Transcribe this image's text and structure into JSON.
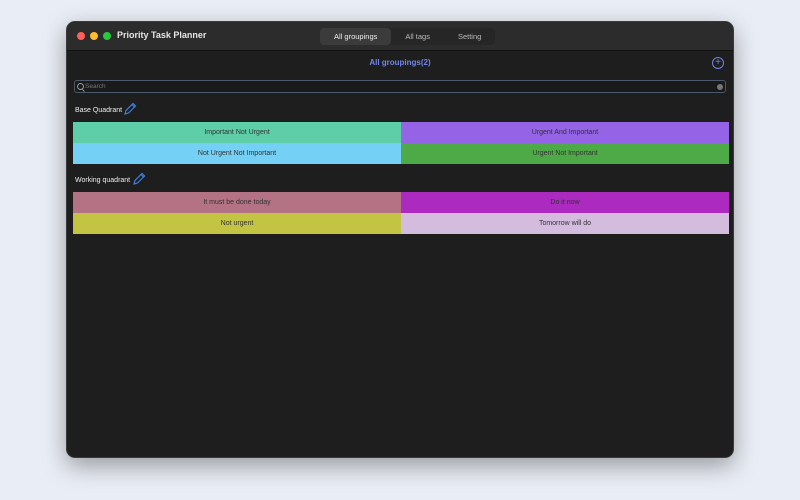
{
  "window": {
    "title": "Priority Task Planner"
  },
  "tabs": [
    {
      "label": "All groupings",
      "active": true
    },
    {
      "label": "All tags"
    },
    {
      "label": "Setting"
    }
  ],
  "header": {
    "title": "All groupings(2)",
    "add_icon": "plus-circle-icon"
  },
  "search": {
    "placeholder": "Search",
    "value": ""
  },
  "groups": [
    {
      "name": "Base Quadrant",
      "cells": [
        {
          "label": "Important Not Urgent",
          "color": "#5ecea8"
        },
        {
          "label": "Urgent And Important",
          "color": "#9463e6"
        },
        {
          "label": "Not Urgent Not Important",
          "color": "#74d0f4"
        },
        {
          "label": "Urgent Not Important",
          "color": "#4eaa47"
        }
      ]
    },
    {
      "name": "Working quadrant",
      "cells": [
        {
          "label": "It must be done today",
          "color": "#b47285"
        },
        {
          "label": "Do it now",
          "color": "#ac2ac0"
        },
        {
          "label": "Not urgent",
          "color": "#c4c443"
        },
        {
          "label": "Tomorrow will do",
          "color": "#d4bcdf"
        }
      ]
    }
  ]
}
